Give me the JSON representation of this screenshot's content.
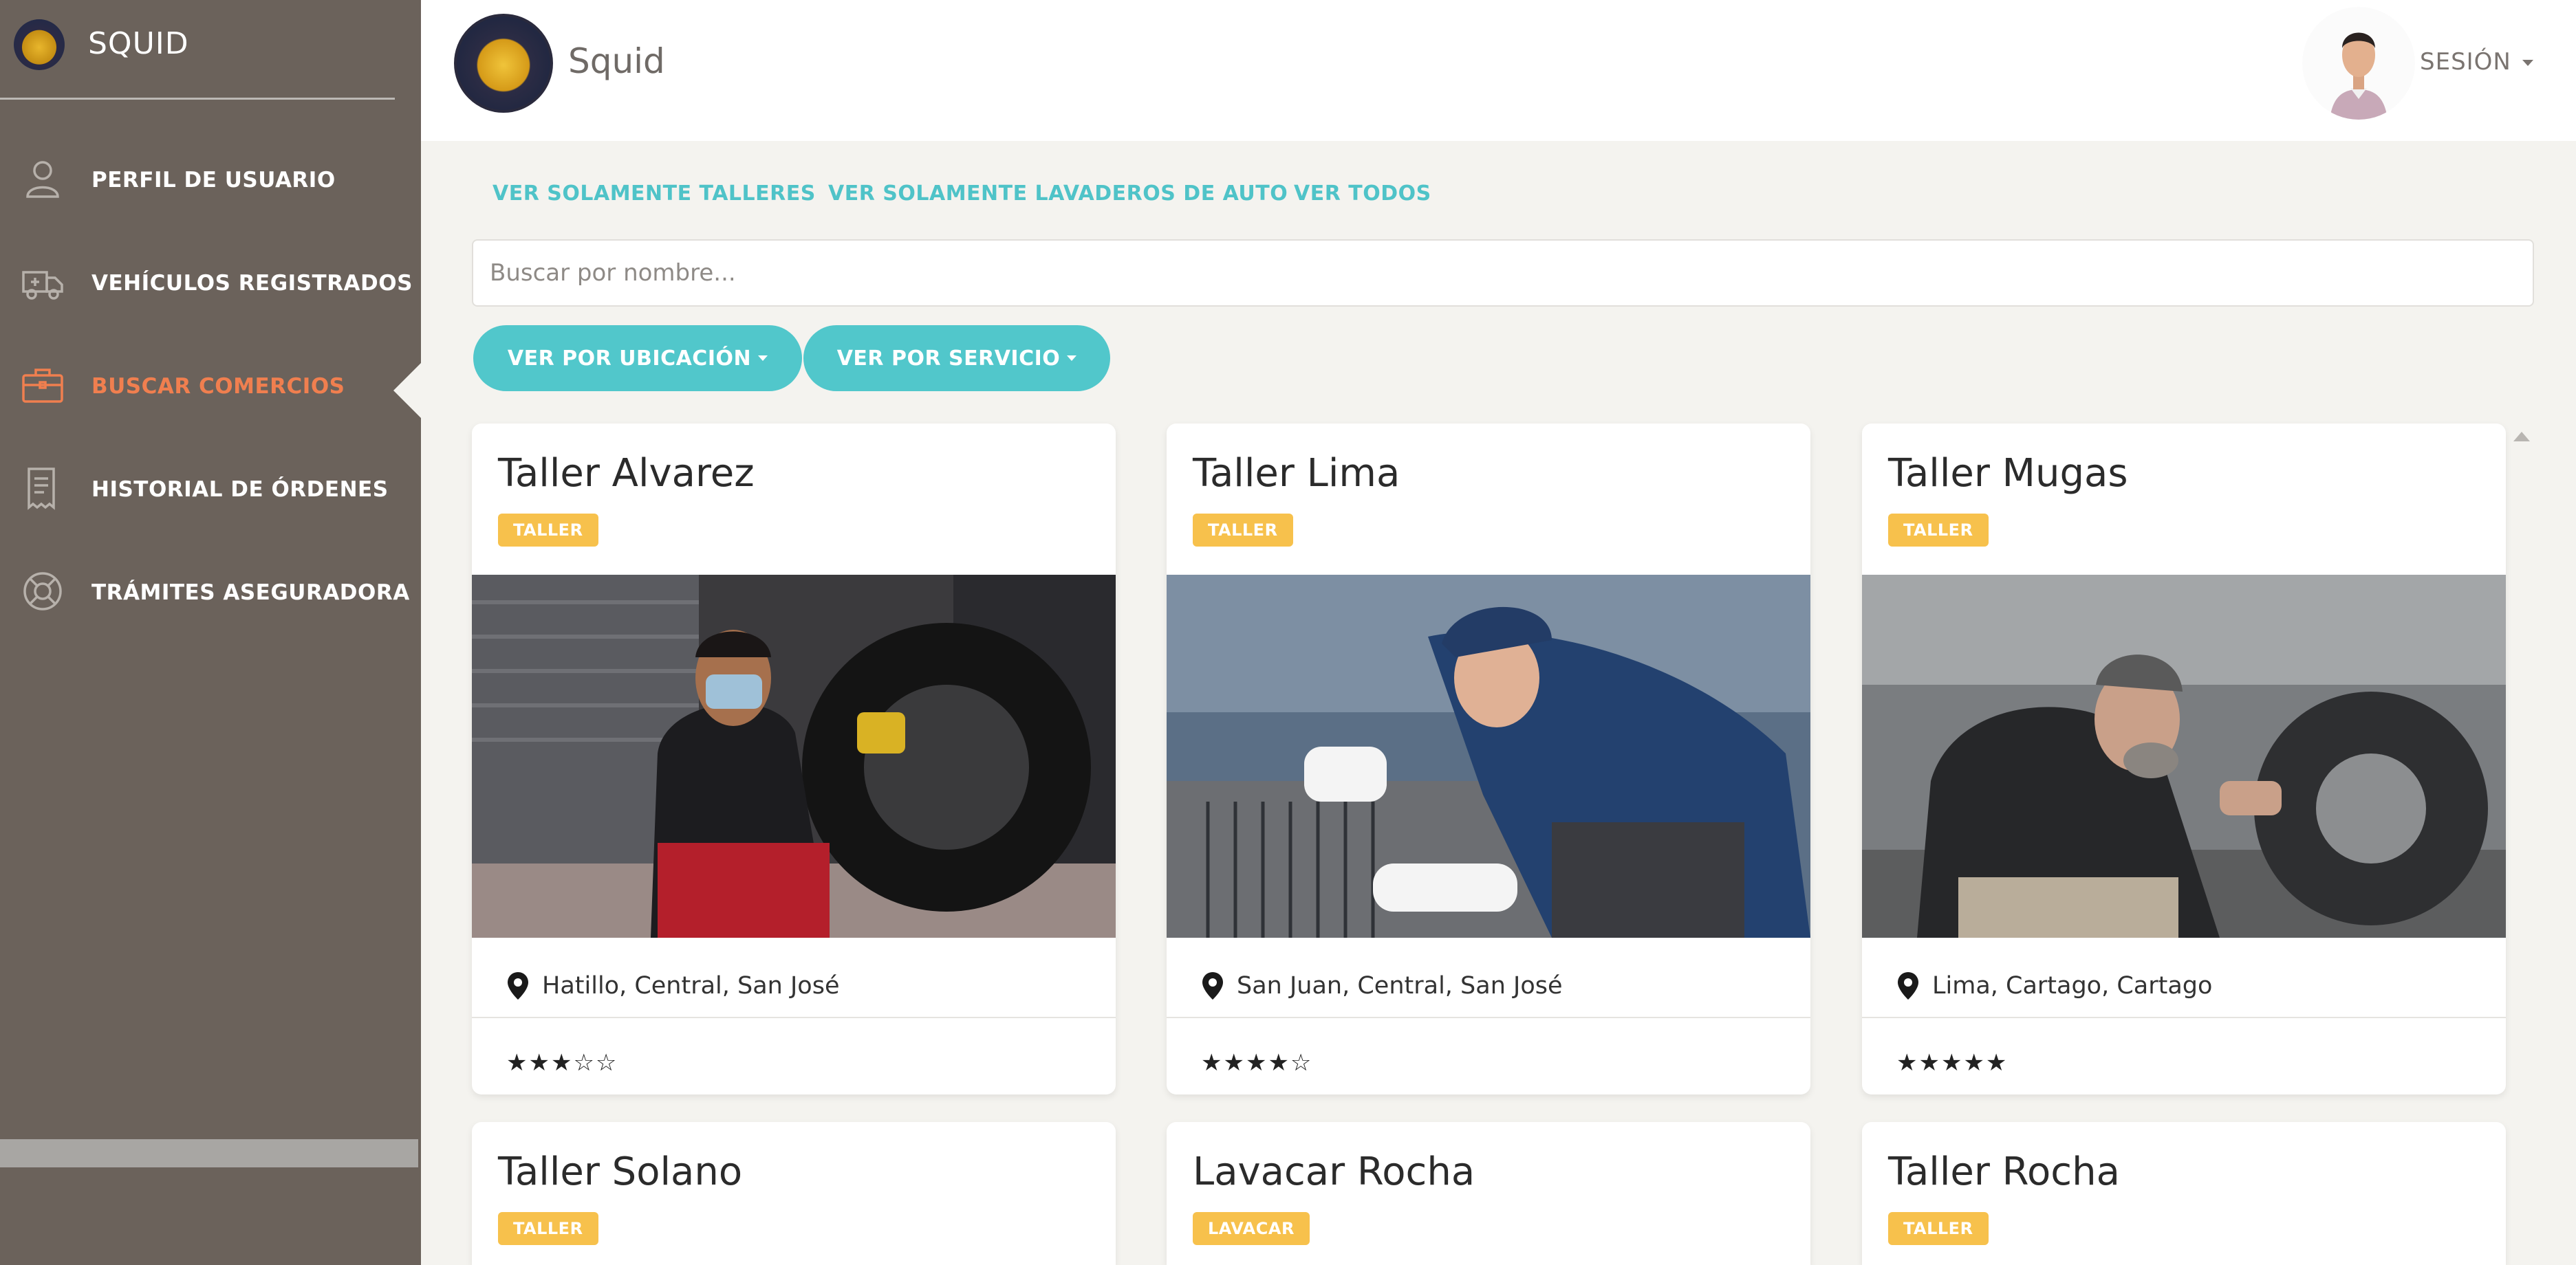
{
  "sidebar": {
    "brand": "SQUID",
    "items": [
      {
        "label": "PERFIL DE USUARIO",
        "icon": "user-icon"
      },
      {
        "label": "VEHÍCULOS REGISTRADOS",
        "icon": "ambulance-icon"
      },
      {
        "label": "BUSCAR COMERCIOS",
        "icon": "briefcase-icon",
        "active": true
      },
      {
        "label": "HISTORIAL DE ÓRDENES",
        "icon": "receipt-icon"
      },
      {
        "label": "TRÁMITES ASEGURADORA",
        "icon": "lifebuoy-icon"
      }
    ],
    "active_color": "#f07f4f"
  },
  "header": {
    "title": "Squid",
    "session_label": "SESIÓN"
  },
  "filters": {
    "links": [
      "VER SOLAMENTE TALLERES",
      "VER SOLAMENTE LAVADEROS DE AUTO",
      "VER TODOS"
    ],
    "search_placeholder": "Buscar por nombre...",
    "buttons": [
      "VER POR UBICACIÓN",
      "VER POR SERVICIO"
    ],
    "accent_color": "#51c7cb"
  },
  "cards": [
    {
      "name": "Taller Alvarez",
      "type": "TALLER",
      "location": "Hatillo, Central, San José",
      "stars": "★★★☆☆",
      "rating": 3
    },
    {
      "name": "Taller Lima",
      "type": "TALLER",
      "location": "San Juan, Central, San José",
      "stars": "★★★★☆",
      "rating": 4
    },
    {
      "name": "Taller Mugas",
      "type": "TALLER",
      "location": "Lima, Cartago, Cartago",
      "stars": "★★★★★",
      "rating": 5
    },
    {
      "name": "Taller Solano",
      "type": "TALLER"
    },
    {
      "name": "Lavacar Rocha",
      "type": "LAVACAR"
    },
    {
      "name": "Taller Rocha",
      "type": "TALLER"
    }
  ]
}
